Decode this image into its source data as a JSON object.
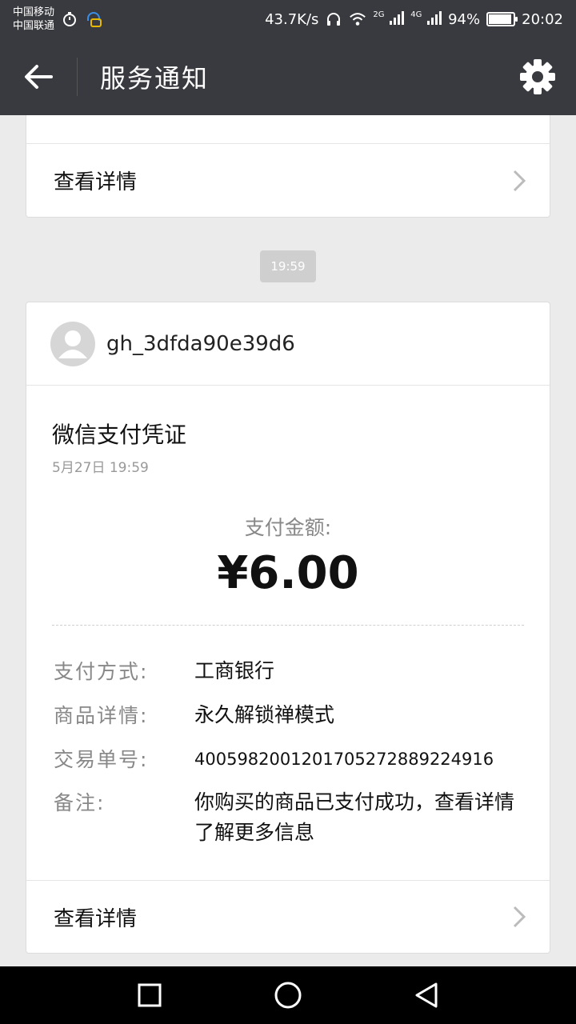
{
  "status_bar": {
    "carrier1": "中国移动",
    "carrier2": "中国联通",
    "speed": "43.7K/s",
    "net_2g": "2G",
    "net_4g": "4G",
    "battery": "94%",
    "battery_level": 0.94,
    "time": "20:02"
  },
  "appbar": {
    "title": "服务通知"
  },
  "top_card": {
    "detail_label": "查看详情"
  },
  "timestamp": "19:59",
  "main_card": {
    "sender": "gh_3dfda90e39d6",
    "title": "微信支付凭证",
    "date": "5月27日  19:59",
    "amount_label": "支付金额:",
    "amount": "¥6.00",
    "fields": [
      {
        "label": "支付方式:",
        "value": "工商银行"
      },
      {
        "label": "商品详情:",
        "value": "永久解锁禅模式"
      },
      {
        "label": "交易单号:",
        "value": "4005982001201705272889224916"
      },
      {
        "label": "备注:",
        "value": "你购买的商品已支付成功，查看详情了解更多信息"
      }
    ],
    "detail_label": "查看详情"
  },
  "colors": {
    "appbar": "#393a3f",
    "background": "#ebebeb",
    "card": "#ffffff"
  }
}
